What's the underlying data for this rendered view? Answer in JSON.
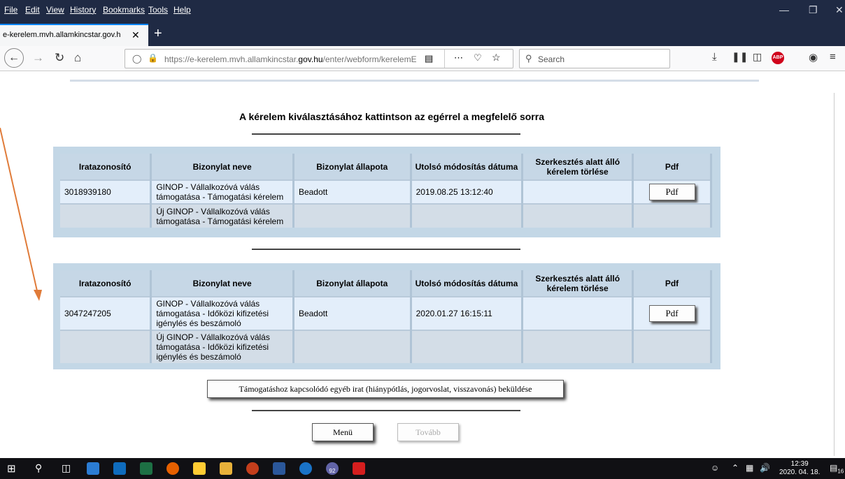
{
  "browser": {
    "menu": [
      "File",
      "Edit",
      "View",
      "History",
      "Bookmarks",
      "Tools",
      "Help"
    ],
    "tab_title": "e-kerelem.mvh.allamkincstar.gov.h",
    "url_prefix": "https://e-kerelem.mvh.allamkincstar.",
    "url_domain": "gov.hu",
    "url_suffix": "/enter/webform/kerelemElö",
    "search_placeholder": "Search",
    "accent": "#0a84ff"
  },
  "page": {
    "heading": "A kérelem kiválasztásához kattintson az egérrel a megfelelő sorra",
    "columns": [
      "Iratazonosító",
      "Bizonylat neve",
      "Bizonylat állapota",
      "Utolsó módosítás dátuma",
      "Szerkesztés alatt álló kérelem törlése",
      "Pdf"
    ],
    "table1": {
      "row1": {
        "id": "3018939180",
        "name": "GINOP - Vállalkozóvá válás támogatása - Támogatási kérelem",
        "status": "Beadott",
        "date": "2019.08.25 13:12:40",
        "pdf": "Pdf"
      },
      "row2": {
        "name": "Új GINOP - Vállalkozóvá válás támogatása - Támogatási kérelem"
      }
    },
    "table2": {
      "row1": {
        "id": "3047247205",
        "name": "GINOP - Vállalkozóvá válás támogatása - Időközi kifizetési igénylés és beszámoló",
        "status": "Beadott",
        "date": "2020.01.27 16:15:11",
        "pdf": "Pdf"
      },
      "row2": {
        "name": "Új GINOP - Vállalkozóvá válás támogatása - Időközi kifizetési igénylés és beszámoló"
      }
    },
    "other_doc_button": "Támogatáshoz kapcsolódó egyéb irat (hiánypótlás, jogorvoslat, visszavonás) beküldése",
    "menu_button": "Menü",
    "next_button": "Tovább",
    "arrow_color": "#e07b39"
  },
  "taskbar": {
    "time": "12:39",
    "date": "2020. 04. 18.",
    "notifications": "16",
    "teams_badge": "92"
  }
}
